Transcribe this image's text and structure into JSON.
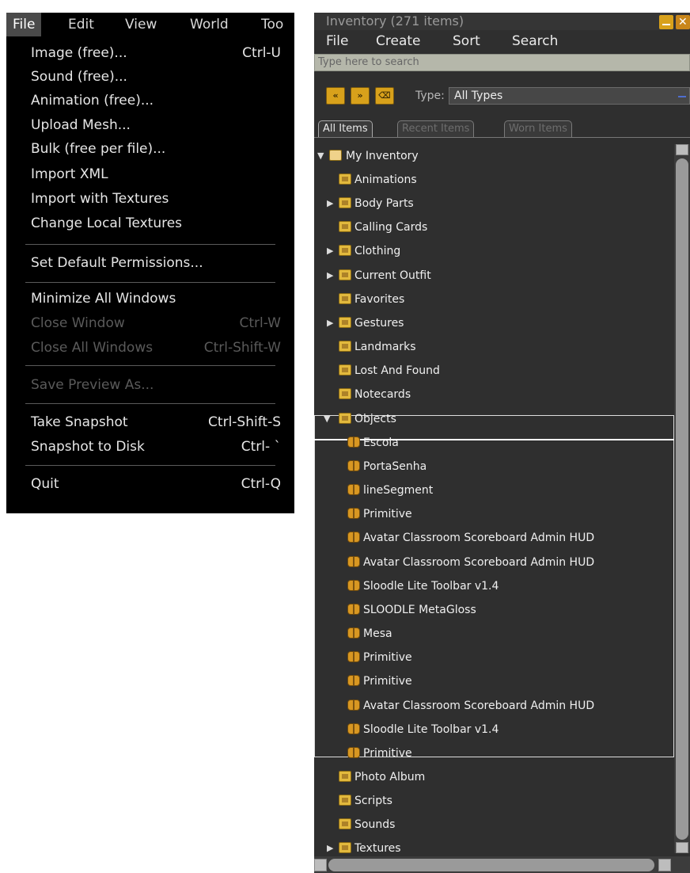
{
  "menubar": {
    "items": [
      "File",
      "Edit",
      "View",
      "World",
      "Too"
    ]
  },
  "file_menu": {
    "items": [
      {
        "label": "Image (free)...",
        "shortcut": "Ctrl-U",
        "enabled": true
      },
      {
        "label": "Sound (free)...",
        "shortcut": "",
        "enabled": true
      },
      {
        "label": "Animation (free)...",
        "shortcut": "",
        "enabled": true
      },
      {
        "label": "Upload Mesh...",
        "shortcut": "",
        "enabled": true
      },
      {
        "label": "Bulk (free per file)...",
        "shortcut": "",
        "enabled": true
      },
      {
        "label": "Import XML",
        "shortcut": "",
        "enabled": true
      },
      {
        "label": "Import with Textures",
        "shortcut": "",
        "enabled": true
      },
      {
        "label": "Change Local Textures",
        "shortcut": "",
        "enabled": true
      },
      {
        "label": "Set Default Permissions...",
        "shortcut": "",
        "enabled": true
      },
      {
        "label": "Minimize All Windows",
        "shortcut": "",
        "enabled": true
      },
      {
        "label": "Close Window",
        "shortcut": "Ctrl-W",
        "enabled": false
      },
      {
        "label": "Close All Windows",
        "shortcut": "Ctrl-Shift-W",
        "enabled": false
      },
      {
        "label": "Save Preview As...",
        "shortcut": "",
        "enabled": false
      },
      {
        "label": "Take Snapshot",
        "shortcut": "Ctrl-Shift-S",
        "enabled": true
      },
      {
        "label": "Snapshot to Disk",
        "shortcut": "Ctrl- `",
        "enabled": true
      },
      {
        "label": "Quit",
        "shortcut": "Ctrl-Q",
        "enabled": true
      }
    ]
  },
  "inventory": {
    "title": "Inventory (271 items)",
    "menu": [
      "File",
      "Create",
      "Sort",
      "Search"
    ],
    "search_placeholder": "Type here to search",
    "type_label": "Type:",
    "type_value": "All Types",
    "tabs": [
      "All Items",
      "Recent Items",
      "Worn Items"
    ],
    "tree": [
      {
        "label": "My Inventory",
        "expanded": true,
        "icon": "folder-open-icon"
      },
      {
        "label": "Animations",
        "icon": "animations-folder-icon"
      },
      {
        "label": "Body Parts",
        "collapsed": true,
        "icon": "body-parts-folder-icon"
      },
      {
        "label": "Calling Cards",
        "icon": "calling-cards-folder-icon"
      },
      {
        "label": "Clothing",
        "collapsed": true,
        "icon": "clothing-folder-icon"
      },
      {
        "label": "Current Outfit",
        "collapsed": true,
        "icon": "current-outfit-folder-icon"
      },
      {
        "label": "Favorites",
        "icon": "favorites-folder-icon"
      },
      {
        "label": "Gestures",
        "collapsed": true,
        "icon": "gestures-folder-icon"
      },
      {
        "label": "Landmarks",
        "icon": "landmarks-folder-icon"
      },
      {
        "label": "Lost And Found",
        "icon": "lost-and-found-folder-icon"
      },
      {
        "label": "Notecards",
        "icon": "notecards-folder-icon"
      },
      {
        "label": "Objects",
        "expanded": true,
        "icon": "objects-folder-icon"
      },
      {
        "label": "Escola",
        "icon": "object-icon"
      },
      {
        "label": "PortaSenha",
        "icon": "object-icon"
      },
      {
        "label": "lineSegment",
        "icon": "object-icon"
      },
      {
        "label": "Primitive",
        "icon": "object-icon"
      },
      {
        "label": "Avatar Classroom Scoreboard Admin HUD",
        "icon": "object-icon"
      },
      {
        "label": "Avatar Classroom Scoreboard Admin HUD",
        "icon": "object-icon"
      },
      {
        "label": "Sloodle Lite Toolbar v1.4",
        "icon": "object-icon"
      },
      {
        "label": "SLOODLE MetaGloss",
        "icon": "object-icon"
      },
      {
        "label": "Mesa",
        "icon": "object-icon"
      },
      {
        "label": "Primitive",
        "icon": "object-icon"
      },
      {
        "label": "Primitive",
        "icon": "object-icon"
      },
      {
        "label": "Avatar Classroom Scoreboard Admin HUD",
        "icon": "object-icon"
      },
      {
        "label": "Sloodle Lite Toolbar v1.4",
        "icon": "object-icon"
      },
      {
        "label": "Primitive",
        "icon": "object-icon"
      },
      {
        "label": "Photo Album",
        "icon": "photo-album-folder-icon"
      },
      {
        "label": "Scripts",
        "icon": "scripts-folder-icon"
      },
      {
        "label": "Sounds",
        "icon": "sounds-folder-icon"
      },
      {
        "label": "Textures",
        "collapsed": true,
        "icon": "textures-folder-icon"
      }
    ]
  },
  "colors": {
    "menu_bg": "#000000",
    "window_bg": "#2f2f2f",
    "accent": "#d8a11b",
    "selection_border": "#ffffff"
  }
}
